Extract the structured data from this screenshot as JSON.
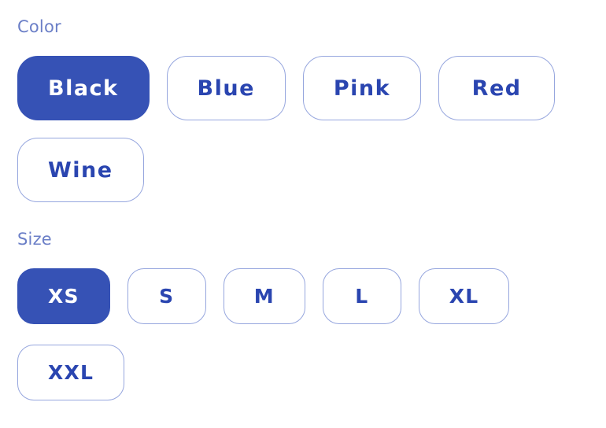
{
  "theme": {
    "accent": "#3652B5",
    "chip_border": "#96A6DE",
    "chip_text": "#2A45B0",
    "label_text": "#6B7FC7",
    "selected_text": "#FFFFFF",
    "background": "#FFFFFF"
  },
  "groups": [
    {
      "label": "Color",
      "selected": "Black",
      "options": [
        {
          "label": "Black",
          "selected": true
        },
        {
          "label": "Blue",
          "selected": false
        },
        {
          "label": "Pink",
          "selected": false
        },
        {
          "label": "Red",
          "selected": false
        },
        {
          "label": "Wine",
          "selected": false
        }
      ]
    },
    {
      "label": "Size",
      "selected": "XS",
      "options": [
        {
          "label": "XS",
          "selected": true
        },
        {
          "label": "S",
          "selected": false
        },
        {
          "label": "M",
          "selected": false
        },
        {
          "label": "L",
          "selected": false
        },
        {
          "label": "XL",
          "selected": false
        },
        {
          "label": "XXL",
          "selected": false
        }
      ]
    }
  ]
}
